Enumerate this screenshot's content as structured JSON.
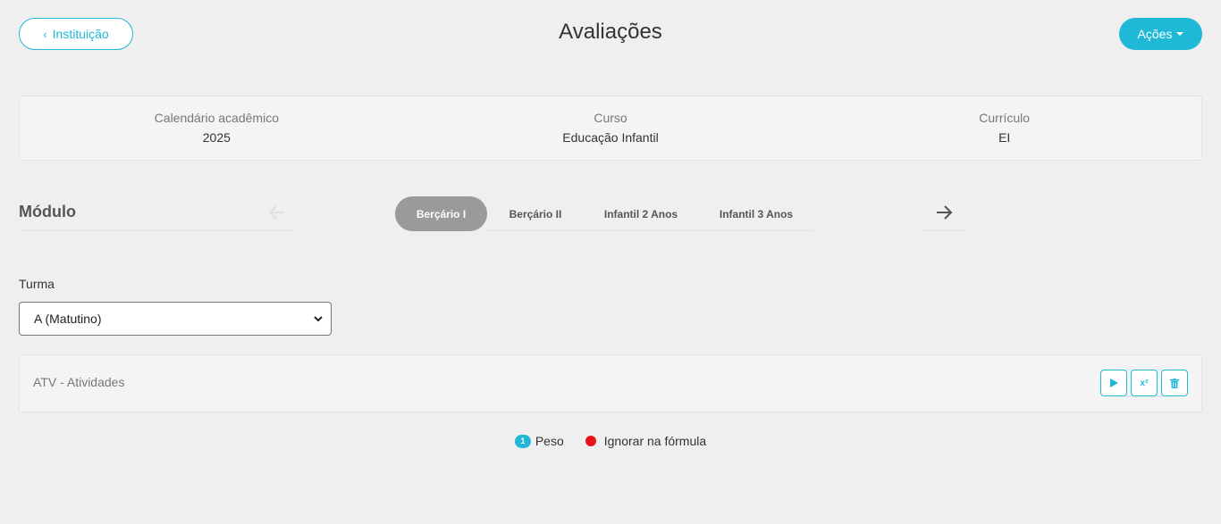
{
  "header": {
    "back_label": "Instituição",
    "title": "Avaliações",
    "actions_label": "Ações"
  },
  "info": {
    "calendar_label": "Calendário acadêmico",
    "calendar_value": "2025",
    "course_label": "Curso",
    "course_value": "Educação Infantil",
    "curriculum_label": "Currículo",
    "curriculum_value": "EI"
  },
  "modulo": {
    "title": "Módulo",
    "tabs": [
      {
        "label": "Berçário I",
        "active": true
      },
      {
        "label": "Berçário II",
        "active": false
      },
      {
        "label": "Infantil 2 Anos",
        "active": false
      },
      {
        "label": "Infantil 3 Anos",
        "active": false
      }
    ]
  },
  "turma": {
    "label": "Turma",
    "selected": "A (Matutino)"
  },
  "atividade": {
    "text": "ATV - Atividades",
    "formula_icon_text": "x²"
  },
  "legend": {
    "badge_number": "1",
    "peso_label": "Peso",
    "ignore_label": "Ignorar na fórmula"
  },
  "colors": {
    "accent": "#1fb8d6",
    "active_tab": "#9a9a9a",
    "ignore_dot": "#e8121a"
  }
}
